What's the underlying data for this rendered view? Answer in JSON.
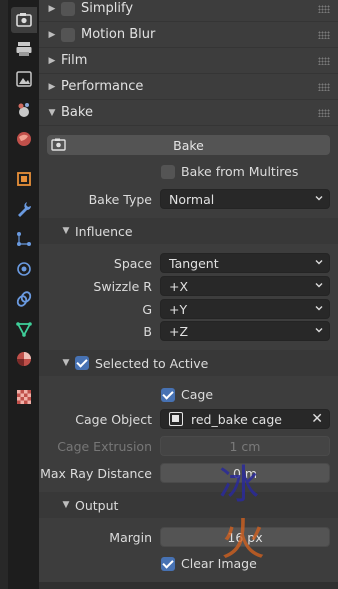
{
  "tabs": [
    {
      "icon": "render-icon",
      "active": true
    },
    {
      "icon": "output-icon"
    },
    {
      "icon": "view-layer-icon"
    },
    {
      "icon": "scene-icon"
    },
    {
      "icon": "world-icon"
    },
    {
      "icon": "object-icon"
    },
    {
      "icon": "modifier-wrench-icon"
    },
    {
      "icon": "particles-icon"
    },
    {
      "icon": "physics-icon"
    },
    {
      "icon": "constraint-icon"
    },
    {
      "icon": "object-data-icon"
    },
    {
      "icon": "material-icon"
    },
    {
      "icon": "texture-icon"
    }
  ],
  "panels": {
    "simplify": "Simplify",
    "motion_blur": "Motion Blur",
    "film": "Film",
    "performance": "Performance",
    "bake": "Bake"
  },
  "bake": {
    "bake_button": "Bake",
    "bake_from_multires": "Bake from Multires",
    "bake_type_label": "Bake Type",
    "bake_type_value": "Normal",
    "influence": {
      "title": "Influence",
      "space_label": "Space",
      "space_value": "Tangent",
      "swizzle_r_label": "Swizzle R",
      "swizzle_r_value": "+X",
      "g_label": "G",
      "g_value": "+Y",
      "b_label": "B",
      "b_value": "+Z"
    },
    "selected_to_active": {
      "title": "Selected to Active",
      "cage_label": "Cage",
      "cage_object_label": "Cage Object",
      "cage_object_value": "red_bake cage",
      "cage_extrusion_label": "Cage Extrusion",
      "cage_extrusion_value": "1 cm",
      "max_ray_distance_label": "Max Ray Distance",
      "max_ray_distance_value": "0 m"
    },
    "output": {
      "title": "Output",
      "margin_label": "Margin",
      "margin_value": "16 px",
      "clear_image_label": "Clear Image"
    }
  },
  "watermark": {
    "top": "冰",
    "bottom": "火"
  },
  "colors": {
    "accent": "#4772b3",
    "panel": "#3d3d3d",
    "field": "#282828",
    "slider": "#545454"
  }
}
